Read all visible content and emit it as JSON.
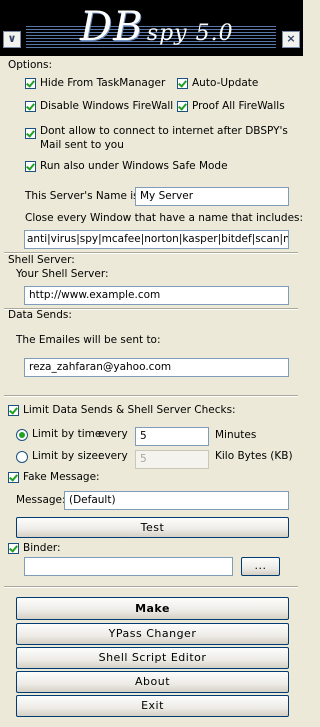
{
  "window": {
    "logo_main": "DB",
    "logo_sub": "spy 5.0",
    "menu_icon": "chevron-down-icon",
    "close_icon": "close-icon",
    "menu_glyph": "∨",
    "close_glyph": "×"
  },
  "options": {
    "heading": "Options:",
    "hide_task_manager": "Hide From TaskManager",
    "auto_update": "Auto-Update",
    "disable_firewall": "Disable Windows FireWall",
    "proof_firewalls": "Proof All FireWalls",
    "dont_allow_line1": "Dont allow to connect to internet after DBSPY's",
    "dont_allow_line2": "Mail sent to you",
    "safe_mode": "Run also under Windows Safe Mode",
    "server_name_label": "This Server's Name is:",
    "server_name_value": "My Server",
    "close_windows_label": "Close every Window that have a name that includes:",
    "close_windows_value": "anti|virus|spy|mcafee|norton|kasper|bitdef|scan|nod"
  },
  "shell": {
    "heading": "Shell Server:",
    "label": "Your Shell Server:",
    "value": "http://www.example.com"
  },
  "data_sends": {
    "heading": "Data Sends:",
    "label": "The Emailes will be sent to:",
    "value": "reza_zahfaran@yahoo.com"
  },
  "limit": {
    "checkbox_label": "Limit Data Sends & Shell Server Checks:",
    "by_time_label": "Limit by time:",
    "by_time_every": "every",
    "by_time_value": "5",
    "by_time_unit": "Minutes",
    "by_size_label": "Limit by size:",
    "by_size_every": "every",
    "by_size_value": "5",
    "by_size_unit": "Kilo Bytes (KB)"
  },
  "fake_message": {
    "checkbox_label": "Fake Message:",
    "message_label": "Message:",
    "message_value": "(Default)",
    "test_button": "Test"
  },
  "binder": {
    "checkbox_label": "Binder:",
    "path_value": "",
    "browse_button": "..."
  },
  "actions": {
    "make": "Make",
    "ypass": "YPass Changer",
    "shell_editor": "Shell Script Editor",
    "about": "About",
    "exit": "Exit"
  },
  "colors": {
    "background": "#ece9d8",
    "check_green": "#21a121",
    "titlebar": "#000000"
  }
}
